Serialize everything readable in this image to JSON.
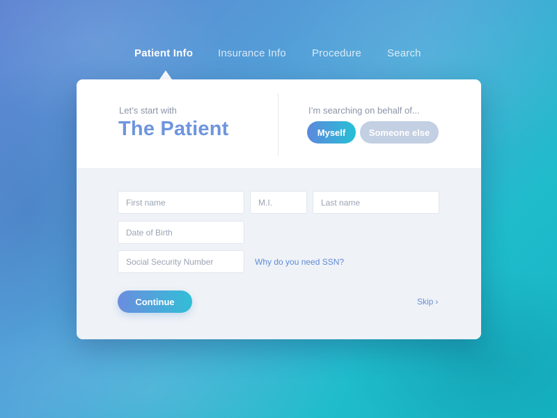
{
  "nav": {
    "items": [
      {
        "label": "Patient Info",
        "active": true
      },
      {
        "label": "Insurance Info",
        "active": false
      },
      {
        "label": "Procedure",
        "active": false
      },
      {
        "label": "Search",
        "active": false
      }
    ]
  },
  "card": {
    "kicker": "Let’s start with",
    "headline": "The Patient",
    "behalf_prompt": "I’m searching on behalf of...",
    "behalf_options": [
      {
        "label": "Myself",
        "selected": true
      },
      {
        "label": "Someone else",
        "selected": false
      }
    ]
  },
  "form": {
    "first_name": {
      "value": "",
      "placeholder": "First name"
    },
    "middle_initial": {
      "value": "",
      "placeholder": "M.I."
    },
    "last_name": {
      "value": "",
      "placeholder": "Last name"
    },
    "date_of_birth": {
      "value": "",
      "placeholder": "Date of Birth"
    },
    "ssn": {
      "value": "",
      "placeholder": "Social Security Number"
    },
    "ssn_help_link": "Why do you need SSN?",
    "continue_label": "Continue",
    "skip_label": "Skip",
    "skip_icon": "chevron-right-icon"
  },
  "colors": {
    "accent_blue": "#6e95de",
    "accent_teal": "#26c0d6",
    "pill_inactive": "#c3cfe2",
    "form_bg": "#eff2f7"
  }
}
